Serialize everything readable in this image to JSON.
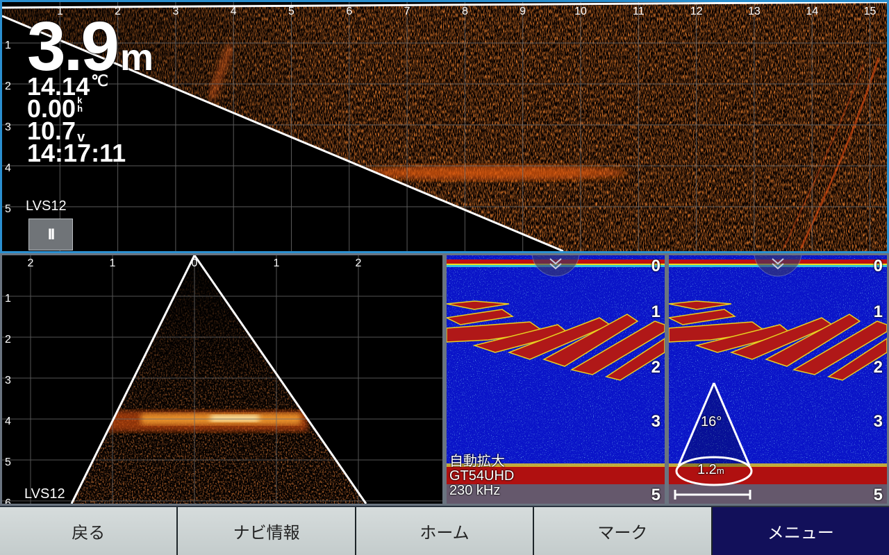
{
  "top_panel": {
    "depth_value": "3.9",
    "depth_unit": "m",
    "water_temp": "14.14",
    "water_temp_unit": "℃",
    "speed": "0.00",
    "speed_unit_top": "k",
    "speed_unit_bottom": "h",
    "voltage": "10.7",
    "voltage_unit": "v",
    "time": "14:17:11",
    "transducer_label": "LVS12",
    "pause_label": "II",
    "x_scale": [
      "1",
      "2",
      "3",
      "4",
      "5",
      "6",
      "7",
      "8",
      "9",
      "10",
      "11",
      "12",
      "13",
      "14",
      "15"
    ],
    "y_scale": [
      "1",
      "2",
      "3",
      "4",
      "5"
    ]
  },
  "bottom_left_panel": {
    "x_scale": [
      "2",
      "1",
      "0",
      "1",
      "2"
    ],
    "y_scale": [
      "1",
      "2",
      "3",
      "4",
      "5",
      "6"
    ],
    "transducer_label": "LVS12"
  },
  "bottom_middle_panel": {
    "depth_scale": [
      "0",
      "1",
      "2",
      "3",
      "5"
    ],
    "zoom_mode": "自動拡大",
    "transducer": "GT54UHD",
    "frequency": "230 kHz"
  },
  "bottom_right_panel": {
    "depth_scale": [
      "0",
      "1",
      "2",
      "3",
      "5"
    ],
    "cone_angle": "16°",
    "cone_diameter": "1.2",
    "cone_diameter_unit": "m"
  },
  "bottom_bar": {
    "buttons": [
      "戻る",
      "ナビ情報",
      "ホーム",
      "マーク",
      "メニュー"
    ],
    "active_index": 4
  },
  "colors": {
    "active_border": "#2a8fd0",
    "sonar_water": "#0a14c8",
    "sonar_bottom": "#b01010",
    "menu_active": "#12105a"
  }
}
